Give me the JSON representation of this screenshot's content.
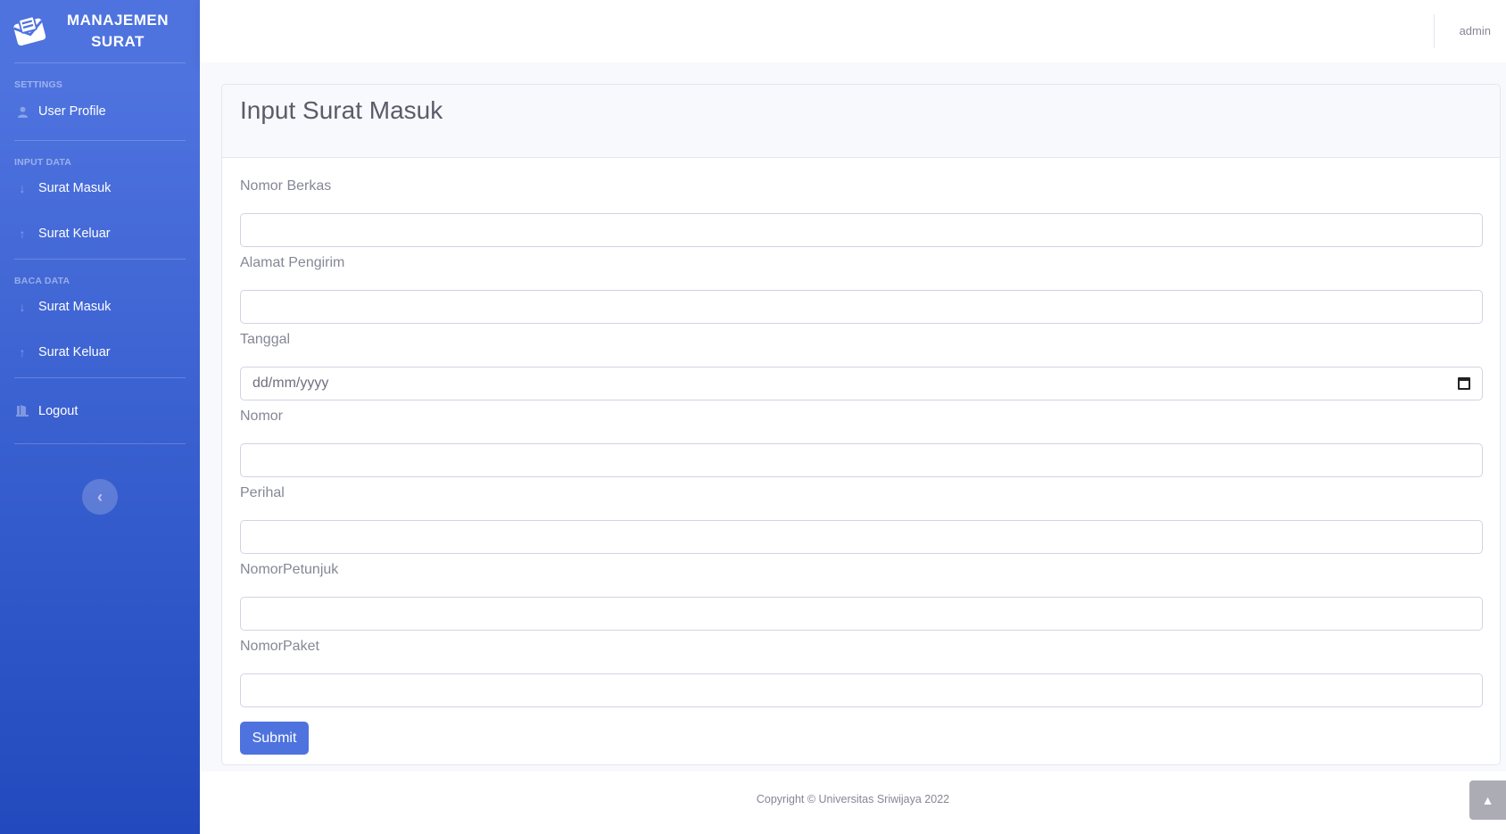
{
  "brand": {
    "line1": "MANAJEMEN",
    "line2": "SURAT"
  },
  "sidebar": {
    "headings": {
      "settings": "SETTINGS",
      "input_data": "INPUT DATA",
      "baca_data": "BACA DATA"
    },
    "items": [
      {
        "label": "User Profile",
        "icon": "user-icon"
      },
      {
        "label": "Surat Masuk",
        "icon": "arrow-down-icon"
      },
      {
        "label": "Surat Keluar",
        "icon": "arrow-up-icon"
      },
      {
        "label": "Surat Masuk",
        "icon": "arrow-down-icon"
      },
      {
        "label": "Surat Keluar",
        "icon": "arrow-up-icon"
      },
      {
        "label": "Logout",
        "icon": "logout-icon"
      }
    ],
    "toggle_icon": "chevron-left-icon"
  },
  "topbar": {
    "user": "admin"
  },
  "page": {
    "title": "Input Surat Masuk"
  },
  "form": {
    "fields": [
      {
        "label": "Nomor Berkas",
        "value": ""
      },
      {
        "label": "Alamat Pengirim",
        "value": ""
      },
      {
        "label": "Tanggal",
        "value": "dd/mm/yyyy"
      },
      {
        "label": "Nomor",
        "value": ""
      },
      {
        "label": "Perihal",
        "value": ""
      },
      {
        "label": "NomorPetunjuk",
        "value": ""
      },
      {
        "label": "NomorPaket",
        "value": ""
      }
    ],
    "submit_label": "Submit"
  },
  "footer": {
    "copyright": "Copyright © Universitas Sriwijaya 2022"
  },
  "colors": {
    "primary": "#4e73df",
    "primary_dark": "#224abe",
    "text_muted": "#858796"
  }
}
